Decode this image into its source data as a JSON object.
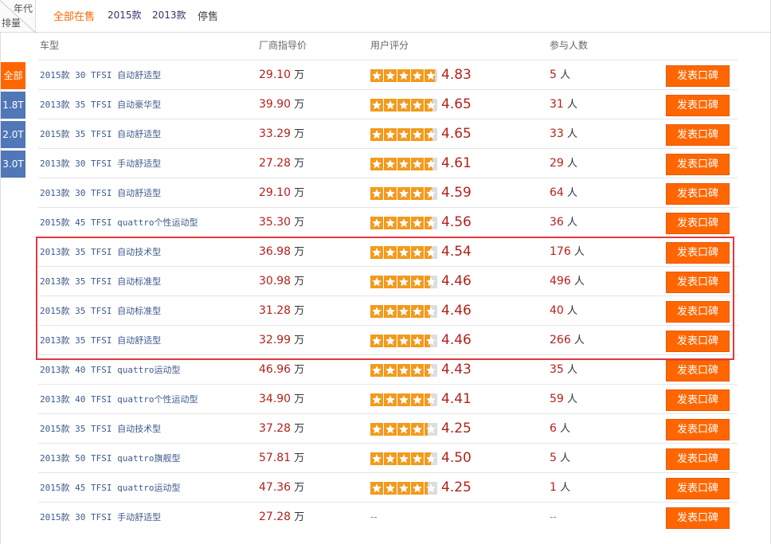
{
  "corner": {
    "top_label": "年代",
    "bottom_label": "排量"
  },
  "tabs": [
    "全部在售",
    "2015款",
    "2013款",
    "停售"
  ],
  "side_tabs": [
    "全部",
    "1.8T",
    "2.0T",
    "3.0T"
  ],
  "headers": {
    "model": "车型",
    "price": "厂商指导价",
    "rating": "用户评分",
    "participants": "参与人数"
  },
  "units": {
    "price": "万",
    "people": "人"
  },
  "button_label": "发表口碑",
  "colors": {
    "accent": "#ff6600",
    "side_inactive": "#5077b6",
    "value_red": "#b3211c",
    "star": "#f39a1c",
    "highlight": "#e0393e"
  },
  "rows": [
    {
      "model": "2015款 30 TFSI 自动舒适型",
      "price": "29.10",
      "score": "4.83",
      "rating": 4.83,
      "people": "5"
    },
    {
      "model": "2013款 35 TFSI 自动豪华型",
      "price": "39.90",
      "score": "4.65",
      "rating": 4.65,
      "people": "31"
    },
    {
      "model": "2015款 35 TFSI 自动舒适型",
      "price": "33.29",
      "score": "4.65",
      "rating": 4.65,
      "people": "33"
    },
    {
      "model": "2013款 30 TFSI 手动舒适型",
      "price": "27.28",
      "score": "4.61",
      "rating": 4.61,
      "people": "29"
    },
    {
      "model": "2013款 30 TFSI 自动舒适型",
      "price": "29.10",
      "score": "4.59",
      "rating": 4.59,
      "people": "64"
    },
    {
      "model": "2015款 45 TFSI quattro个性运动型",
      "price": "35.30",
      "score": "4.56",
      "rating": 4.56,
      "people": "36"
    },
    {
      "model": "2013款 35 TFSI 自动技术型",
      "price": "36.98",
      "score": "4.54",
      "rating": 4.54,
      "people": "176"
    },
    {
      "model": "2013款 35 TFSI 自动标准型",
      "price": "30.98",
      "score": "4.46",
      "rating": 4.46,
      "people": "496"
    },
    {
      "model": "2015款 35 TFSI 自动标准型",
      "price": "31.28",
      "score": "4.46",
      "rating": 4.46,
      "people": "40"
    },
    {
      "model": "2013款 35 TFSI 自动舒适型",
      "price": "32.99",
      "score": "4.46",
      "rating": 4.46,
      "people": "266"
    },
    {
      "model": "2013款 40 TFSI quattro运动型",
      "price": "46.96",
      "score": "4.43",
      "rating": 4.43,
      "people": "35"
    },
    {
      "model": "2013款 40 TFSI quattro个性运动型",
      "price": "34.90",
      "score": "4.41",
      "rating": 4.41,
      "people": "59"
    },
    {
      "model": "2015款 35 TFSI 自动技术型",
      "price": "37.28",
      "score": "4.25",
      "rating": 4.25,
      "people": "6"
    },
    {
      "model": "2013款 50 TFSI quattro旗舰型",
      "price": "57.81",
      "score": "4.50",
      "rating": 4.5,
      "people": "5"
    },
    {
      "model": "2015款 45 TFSI quattro运动型",
      "price": "47.36",
      "score": "4.25",
      "rating": 4.25,
      "people": "1"
    },
    {
      "model": "2015款 30 TFSI 手动舒适型",
      "price": "27.28",
      "score": "--",
      "rating": null,
      "people": "--"
    }
  ]
}
